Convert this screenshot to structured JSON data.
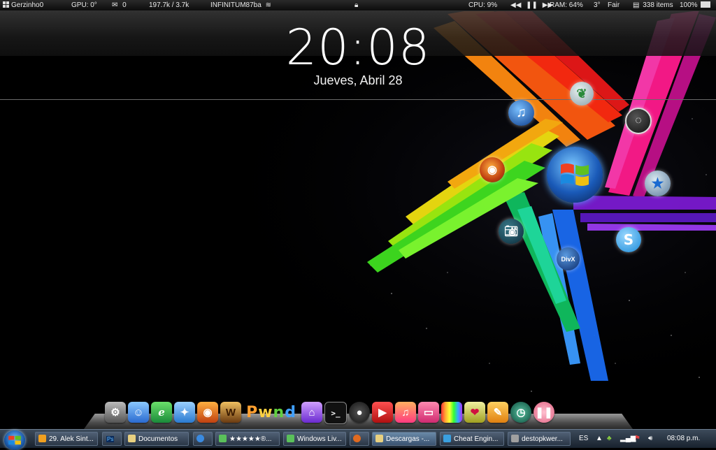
{
  "statusbar": {
    "user": "Gerzinho0",
    "gpu": "GPU: 0°",
    "mail": "0",
    "network_speed": "197.7k / 3.7k",
    "wifi": "INFINITUM87ba",
    "cpu": "CPU: 9%",
    "ram": "RAM: 64%",
    "weather_temp": "3°",
    "weather_text": "Fair",
    "items": "338 items",
    "battery": "100%"
  },
  "clock": {
    "time": "20:08",
    "date": "Jueves, Abril 28"
  },
  "orbs": {
    "divx": "DivX"
  },
  "dock": {
    "items": [
      "system-preferences",
      "finder",
      "internet-explorer",
      "safari",
      "firefox",
      "warcraft",
      "pwned-text",
      "feather",
      "home",
      "terminal",
      "webcam",
      "youtube",
      "itunes",
      "photos",
      "colors",
      "lips",
      "settings",
      "time-machine",
      "pause"
    ]
  },
  "taskbar": {
    "buttons": [
      {
        "label": "29. Alek Sint..."
      },
      {
        "label": "Ps"
      },
      {
        "label": "Documentos"
      },
      {
        "label": ""
      },
      {
        "label": "★★★★★®..."
      },
      {
        "label": "Windows Liv..."
      },
      {
        "label": ""
      },
      {
        "label": "Descargas -..."
      },
      {
        "label": "Cheat Engin..."
      },
      {
        "label": "destopkwer..."
      }
    ],
    "language": "ES",
    "time": "08:08 p.m."
  },
  "colors": {
    "accent_blue": "#1b5aa8",
    "taskbar_top": "#3c4a5a",
    "taskbar_bottom": "#18222e"
  }
}
